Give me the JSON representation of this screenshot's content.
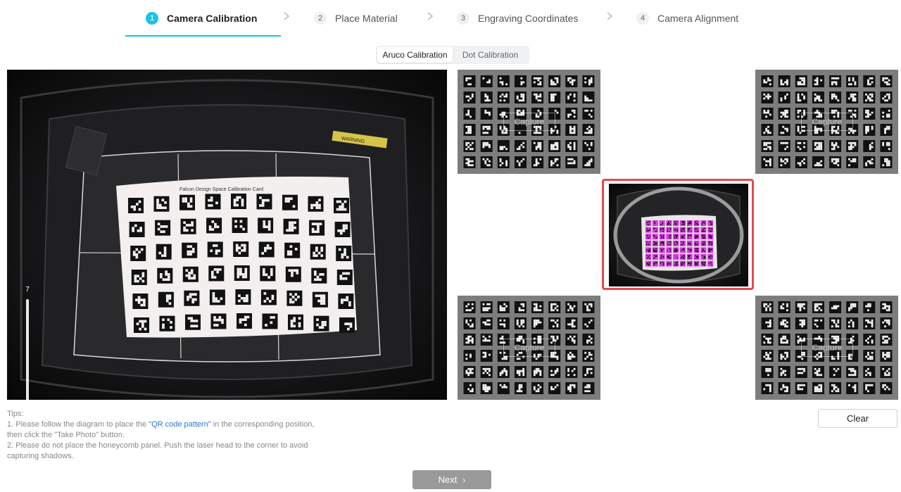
{
  "stepper": {
    "steps": [
      {
        "num": "1",
        "label": "Camera Calibration",
        "active": true
      },
      {
        "num": "2",
        "label": "Place Material",
        "active": false
      },
      {
        "num": "3",
        "label": "Engraving Coordinates",
        "active": false
      },
      {
        "num": "4",
        "label": "Camera Alignment",
        "active": false
      }
    ]
  },
  "calibration_mode": {
    "options": [
      "Aruco Calibration",
      "Dot Calibration"
    ],
    "selected": "Aruco Calibration"
  },
  "camera": {
    "card_title": "Falcon Design Space Calibration Card",
    "warning_label": "WARNING",
    "brightness_value": "7",
    "brightness_level": 0.04
  },
  "capture_cards": {
    "top_left": "Capture",
    "top_right": "Capture",
    "bottom_left": "Capture",
    "bottom_right": "Capture"
  },
  "colors": {
    "accent": "#1cc4de",
    "selected_border": "#e34b4b",
    "link": "#2a74d6",
    "marker_highlight": "#d63adf"
  },
  "tips": {
    "title": "Tips:",
    "line1_prefix": "1. Please follow the diagram to place the ",
    "line1_link": "\"QR code pattern\"",
    "line1_suffix": " in the corresponding position,",
    "line2": "then click the \"Take Photo\" button.",
    "line3": "2. Please do not place the honeycomb panel. Push the laser head to the corner to avoid",
    "line4": "capturing shadows."
  },
  "buttons": {
    "clear": "Clear",
    "next": "Next"
  }
}
